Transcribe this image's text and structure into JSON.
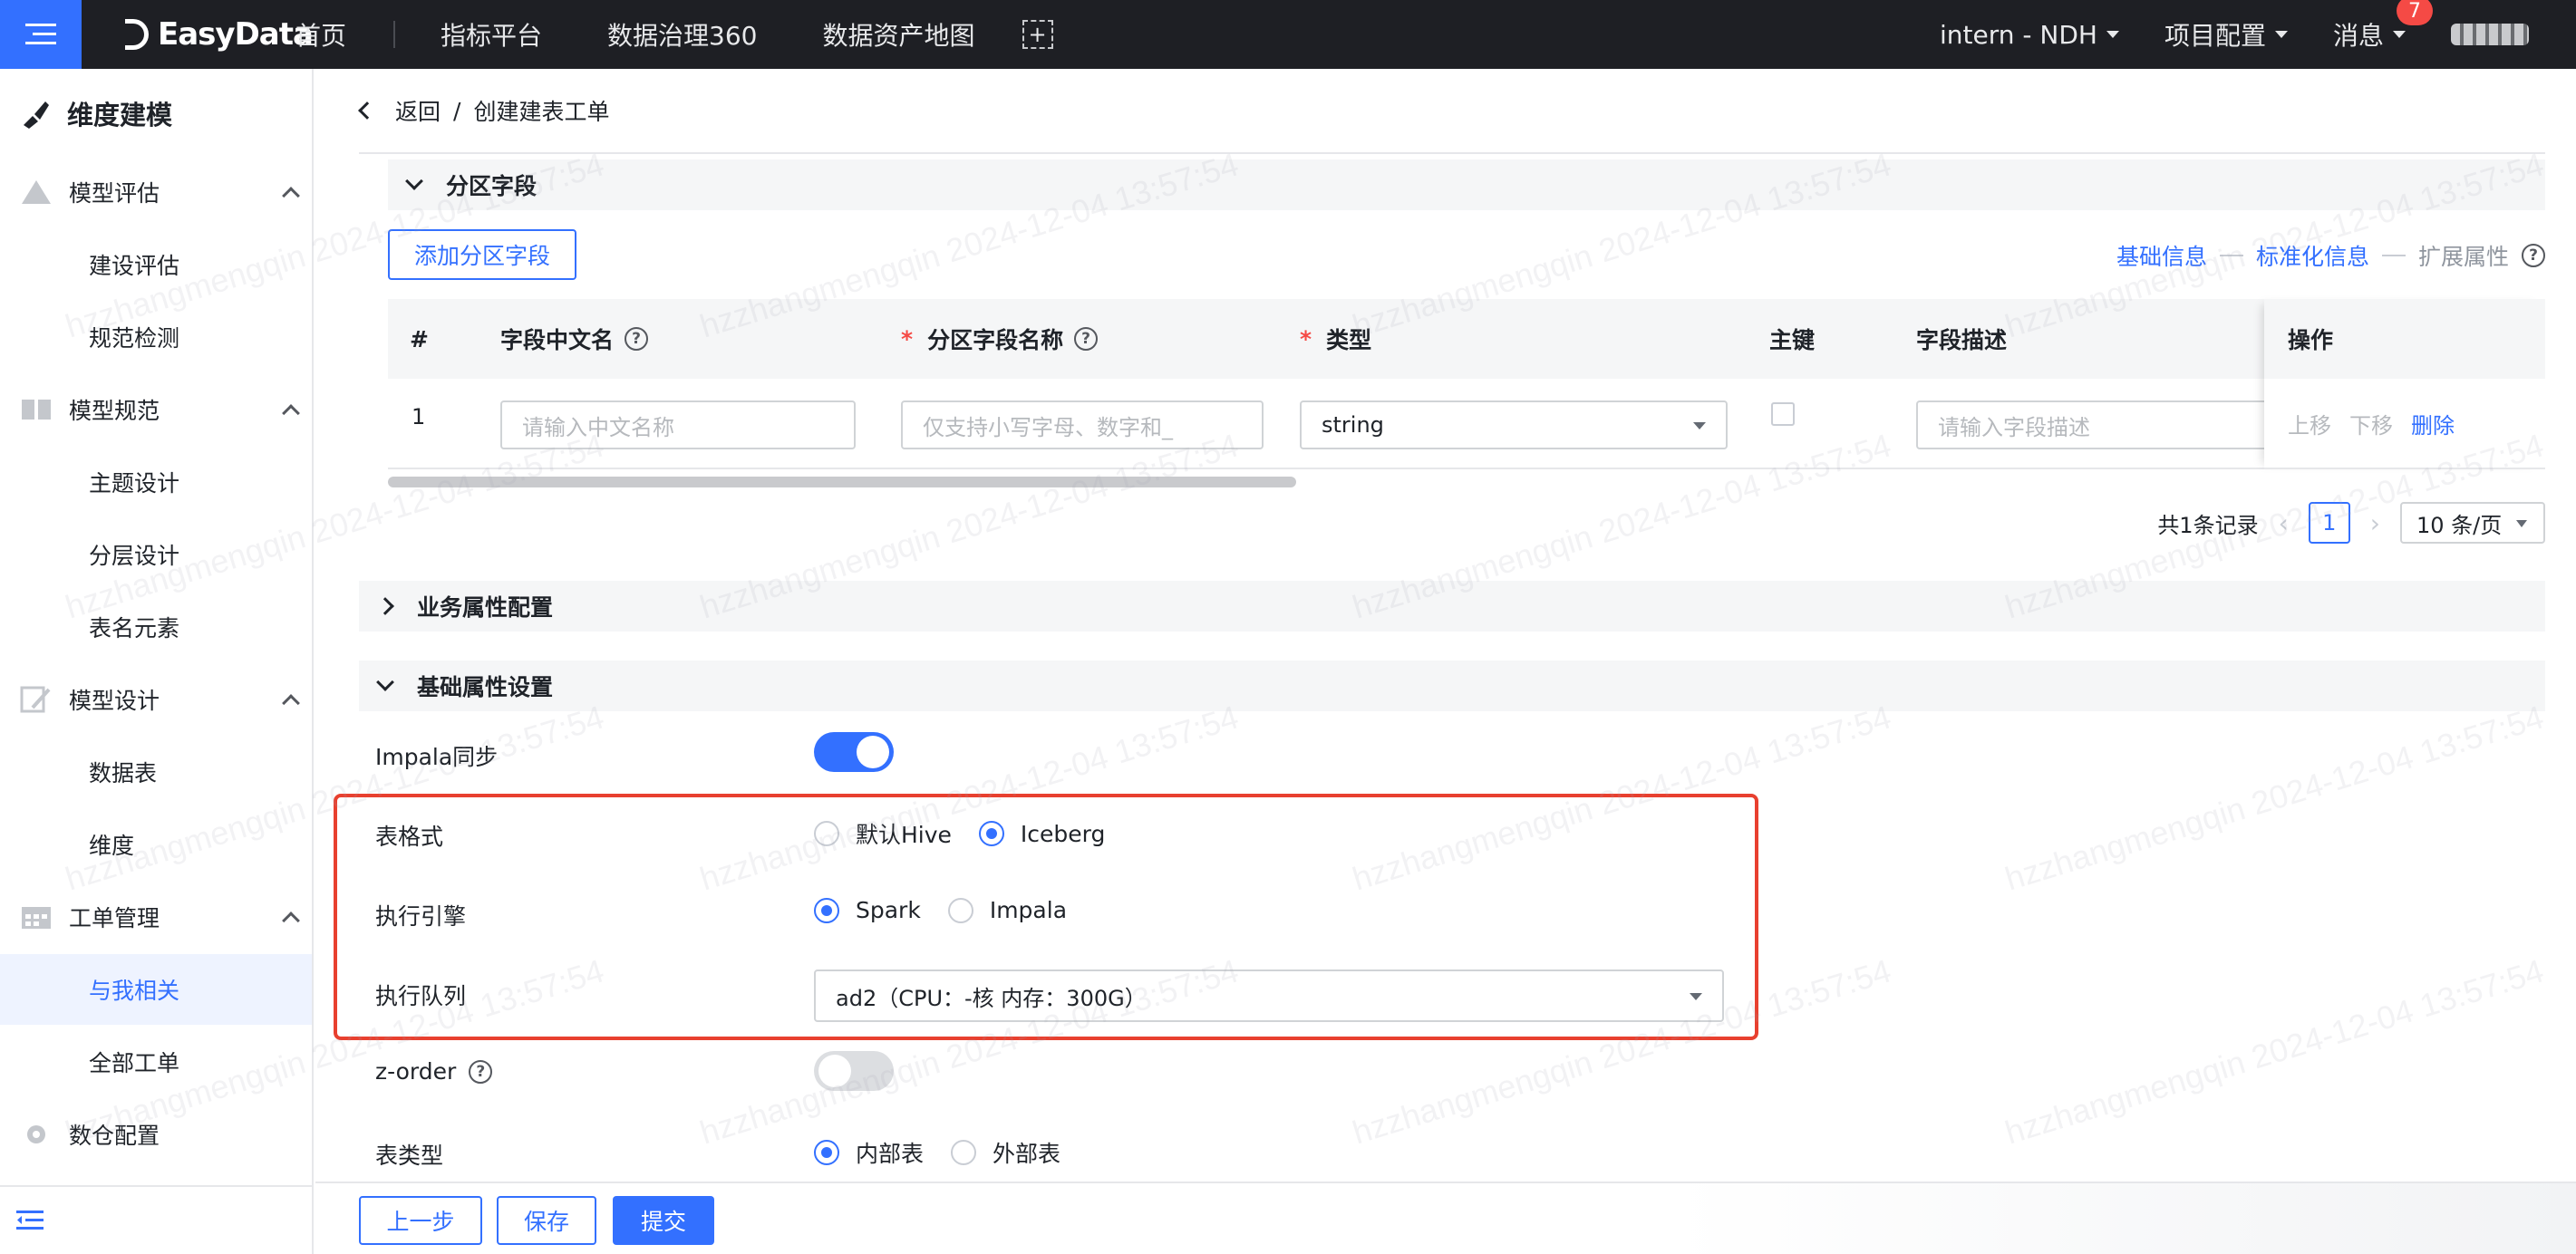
{
  "topbar": {
    "logo": "EasyData",
    "nav": [
      "首页",
      "指标平台",
      "数据治理360",
      "数据资产地图"
    ],
    "project": "intern - NDH",
    "project_config": "项目配置",
    "messages": "消息",
    "message_count": "7"
  },
  "sidebar": {
    "title": "维度建模",
    "groups": [
      {
        "label": "模型评估",
        "icon": "triangle-icon",
        "items": [
          "建设评估",
          "规范检测"
        ]
      },
      {
        "label": "模型规范",
        "icon": "book-icon",
        "items": [
          "主题设计",
          "分层设计",
          "表名元素"
        ]
      },
      {
        "label": "模型设计",
        "icon": "design-icon",
        "items": [
          "数据表",
          "维度"
        ]
      },
      {
        "label": "工单管理",
        "icon": "calendar-icon",
        "items": [
          "与我相关",
          "全部工单"
        ]
      }
    ],
    "active_item": "与我相关",
    "bottom_group": "数仓配置"
  },
  "breadcrumb": {
    "back": "返回",
    "separator": "/",
    "current": "创建建表工单"
  },
  "partition_section": {
    "title": "分区字段",
    "add_button": "添加分区字段",
    "steps": [
      "基础信息",
      "标准化信息",
      "扩展属性"
    ],
    "columns": [
      "#",
      "字段中文名",
      "分区字段名称",
      "类型",
      "主键",
      "字段描述",
      "操作"
    ],
    "rows": [
      {
        "index": "1",
        "cn_name_placeholder": "请输入中文名称",
        "field_name_placeholder": "仅支持小写字母、数字和_",
        "type": "string",
        "desc_placeholder": "请输入字段描述",
        "ops": [
          "上移",
          "下移",
          "删除"
        ]
      }
    ],
    "pagination": {
      "total": "共1条记录",
      "page": "1",
      "page_size": "10 条/页"
    }
  },
  "business_section": {
    "title": "业务属性配置"
  },
  "basic_section": {
    "title": "基础属性设置",
    "impala_sync": {
      "label": "Impala同步",
      "enabled": true
    },
    "table_format": {
      "label": "表格式",
      "options": [
        "默认Hive",
        "Iceberg"
      ],
      "selected": "Iceberg"
    },
    "engine": {
      "label": "执行引擎",
      "options": [
        "Spark",
        "Impala"
      ],
      "selected": "Spark"
    },
    "queue": {
      "label": "执行队列",
      "value": "ad2（CPU：-核 内存：300G）"
    },
    "zorder": {
      "label": "z-order",
      "enabled": false
    },
    "table_type": {
      "label": "表类型",
      "options": [
        "内部表",
        "外部表"
      ],
      "selected": "内部表"
    }
  },
  "footer": {
    "prev": "上一步",
    "save": "保存",
    "submit": "提交"
  },
  "watermark": "hzzhangmengqin 2024-12-04 13:57:54",
  "colors": {
    "primary": "#3370ff",
    "topbar": "#1e1f24",
    "highlight": "#e8402f",
    "badge": "#f54a45"
  }
}
